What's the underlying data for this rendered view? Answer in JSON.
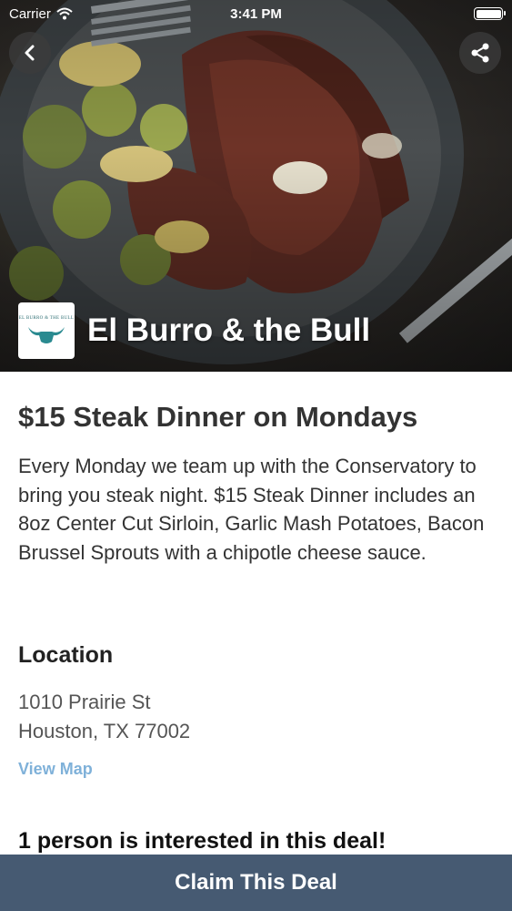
{
  "status_bar": {
    "carrier": "Carrier",
    "time": "3:41 PM",
    "battery_level": 1.0
  },
  "header": {
    "back_icon": "chevron-left-icon",
    "share_icon": "share-icon",
    "venue_name": "El Burro & the Bull",
    "logo_text": "EL BURRO & THE BULL"
  },
  "deal": {
    "title": "$15 Steak Dinner on Mondays",
    "description": "Every Monday we team up with the Conservatory to bring you steak night. $15 Steak Dinner includes an 8oz Center Cut Sirloin, Garlic Mash Potatoes, Bacon Brussel Sprouts with a chipotle cheese sauce."
  },
  "location": {
    "heading": "Location",
    "address_line1": "1010 Prairie St",
    "address_line2": "Houston, TX 77002",
    "view_map_label": "View Map"
  },
  "interest_text": "1 person is interested in this deal!",
  "claim_button_label": "Claim This Deal",
  "colors": {
    "claim_bar": "#465a72",
    "link": "#7fb1d9",
    "logo_accent": "#2a8a90"
  }
}
